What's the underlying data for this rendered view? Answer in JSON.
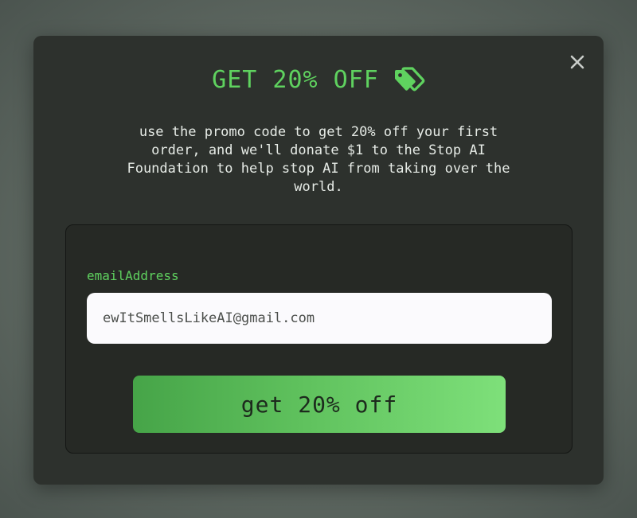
{
  "modal": {
    "title": "GET 20% OFF",
    "title_icon": "tag-icon",
    "close_icon": "close-icon",
    "description": "use the promo code to get 20% off your first order, and we'll donate $1 to the Stop AI Foundation to help stop AI from taking over the world.",
    "form": {
      "email_label": "emailAddress",
      "email_value": "ewItSmellsLikeAI@gmail.com",
      "submit_label": "get 20% off"
    }
  },
  "colors": {
    "accent": "#5fd25f",
    "modal_bg": "#2d312d",
    "card_bg": "#262925",
    "button_start": "#46a448",
    "button_end": "#7ee07a"
  }
}
